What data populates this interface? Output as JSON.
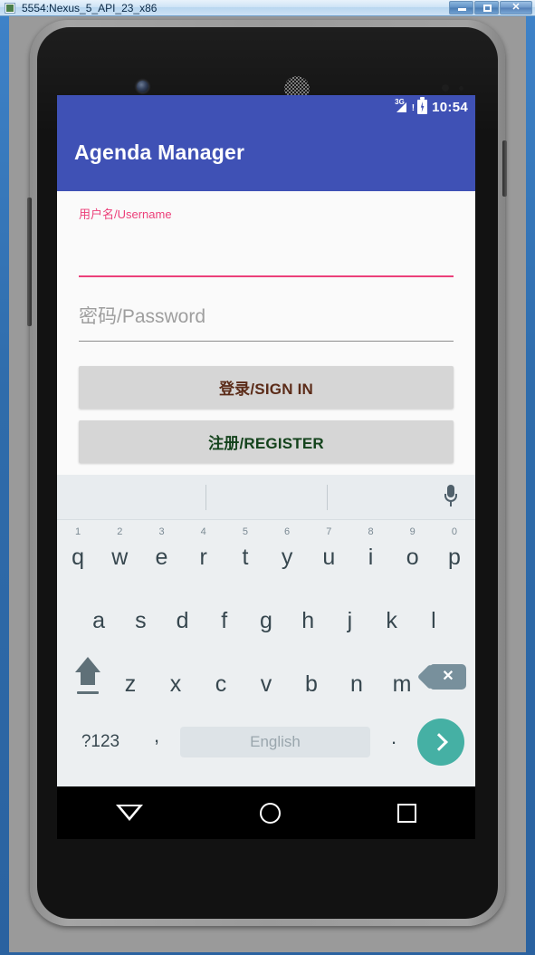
{
  "window": {
    "title": "5554:Nexus_5_API_23_x86",
    "minimize_label": "",
    "maximize_label": "",
    "close_label": "✕"
  },
  "status_bar": {
    "network": "3G",
    "network_alert": "!",
    "battery_icon": "battery-charging-icon",
    "time": "10:54"
  },
  "app_bar": {
    "title": "Agenda Manager",
    "color": "#3f51b5"
  },
  "form": {
    "username": {
      "label": "用户名/Username",
      "value": "",
      "focused": true,
      "accent": "#ec407a"
    },
    "password": {
      "placeholder": "密码/Password",
      "value": "",
      "focused": false,
      "underline": "#8d8d8d"
    },
    "sign_in_label": "登录/SIGN IN",
    "sign_in_color": "#5b2b18",
    "register_label": "注册/REGISTER",
    "register_color": "#14431c",
    "button_bg": "#d6d6d6"
  },
  "keyboard": {
    "suggestions": [
      "",
      "",
      ""
    ],
    "mic_icon": "microphone-icon",
    "row1": [
      {
        "ch": "q",
        "num": "1"
      },
      {
        "ch": "w",
        "num": "2"
      },
      {
        "ch": "e",
        "num": "3"
      },
      {
        "ch": "r",
        "num": "4"
      },
      {
        "ch": "t",
        "num": "5"
      },
      {
        "ch": "y",
        "num": "6"
      },
      {
        "ch": "u",
        "num": "7"
      },
      {
        "ch": "i",
        "num": "8"
      },
      {
        "ch": "o",
        "num": "9"
      },
      {
        "ch": "p",
        "num": "0"
      }
    ],
    "row2": [
      "a",
      "s",
      "d",
      "f",
      "g",
      "h",
      "j",
      "k",
      "l"
    ],
    "row3": [
      "z",
      "x",
      "c",
      "v",
      "b",
      "n",
      "m"
    ],
    "shift_icon": "shift-icon",
    "backspace_icon": "backspace-icon",
    "backspace_glyph": "✕",
    "symbols_label": "?123",
    "comma_label": ",",
    "space_label": "English",
    "period_label": ".",
    "enter_icon": "enter-chevron-icon",
    "enter_color": "#45b0a4"
  },
  "nav_bar": {
    "back_icon": "back-triangle-icon",
    "home_icon": "home-circle-icon",
    "recents_icon": "recents-square-icon"
  }
}
